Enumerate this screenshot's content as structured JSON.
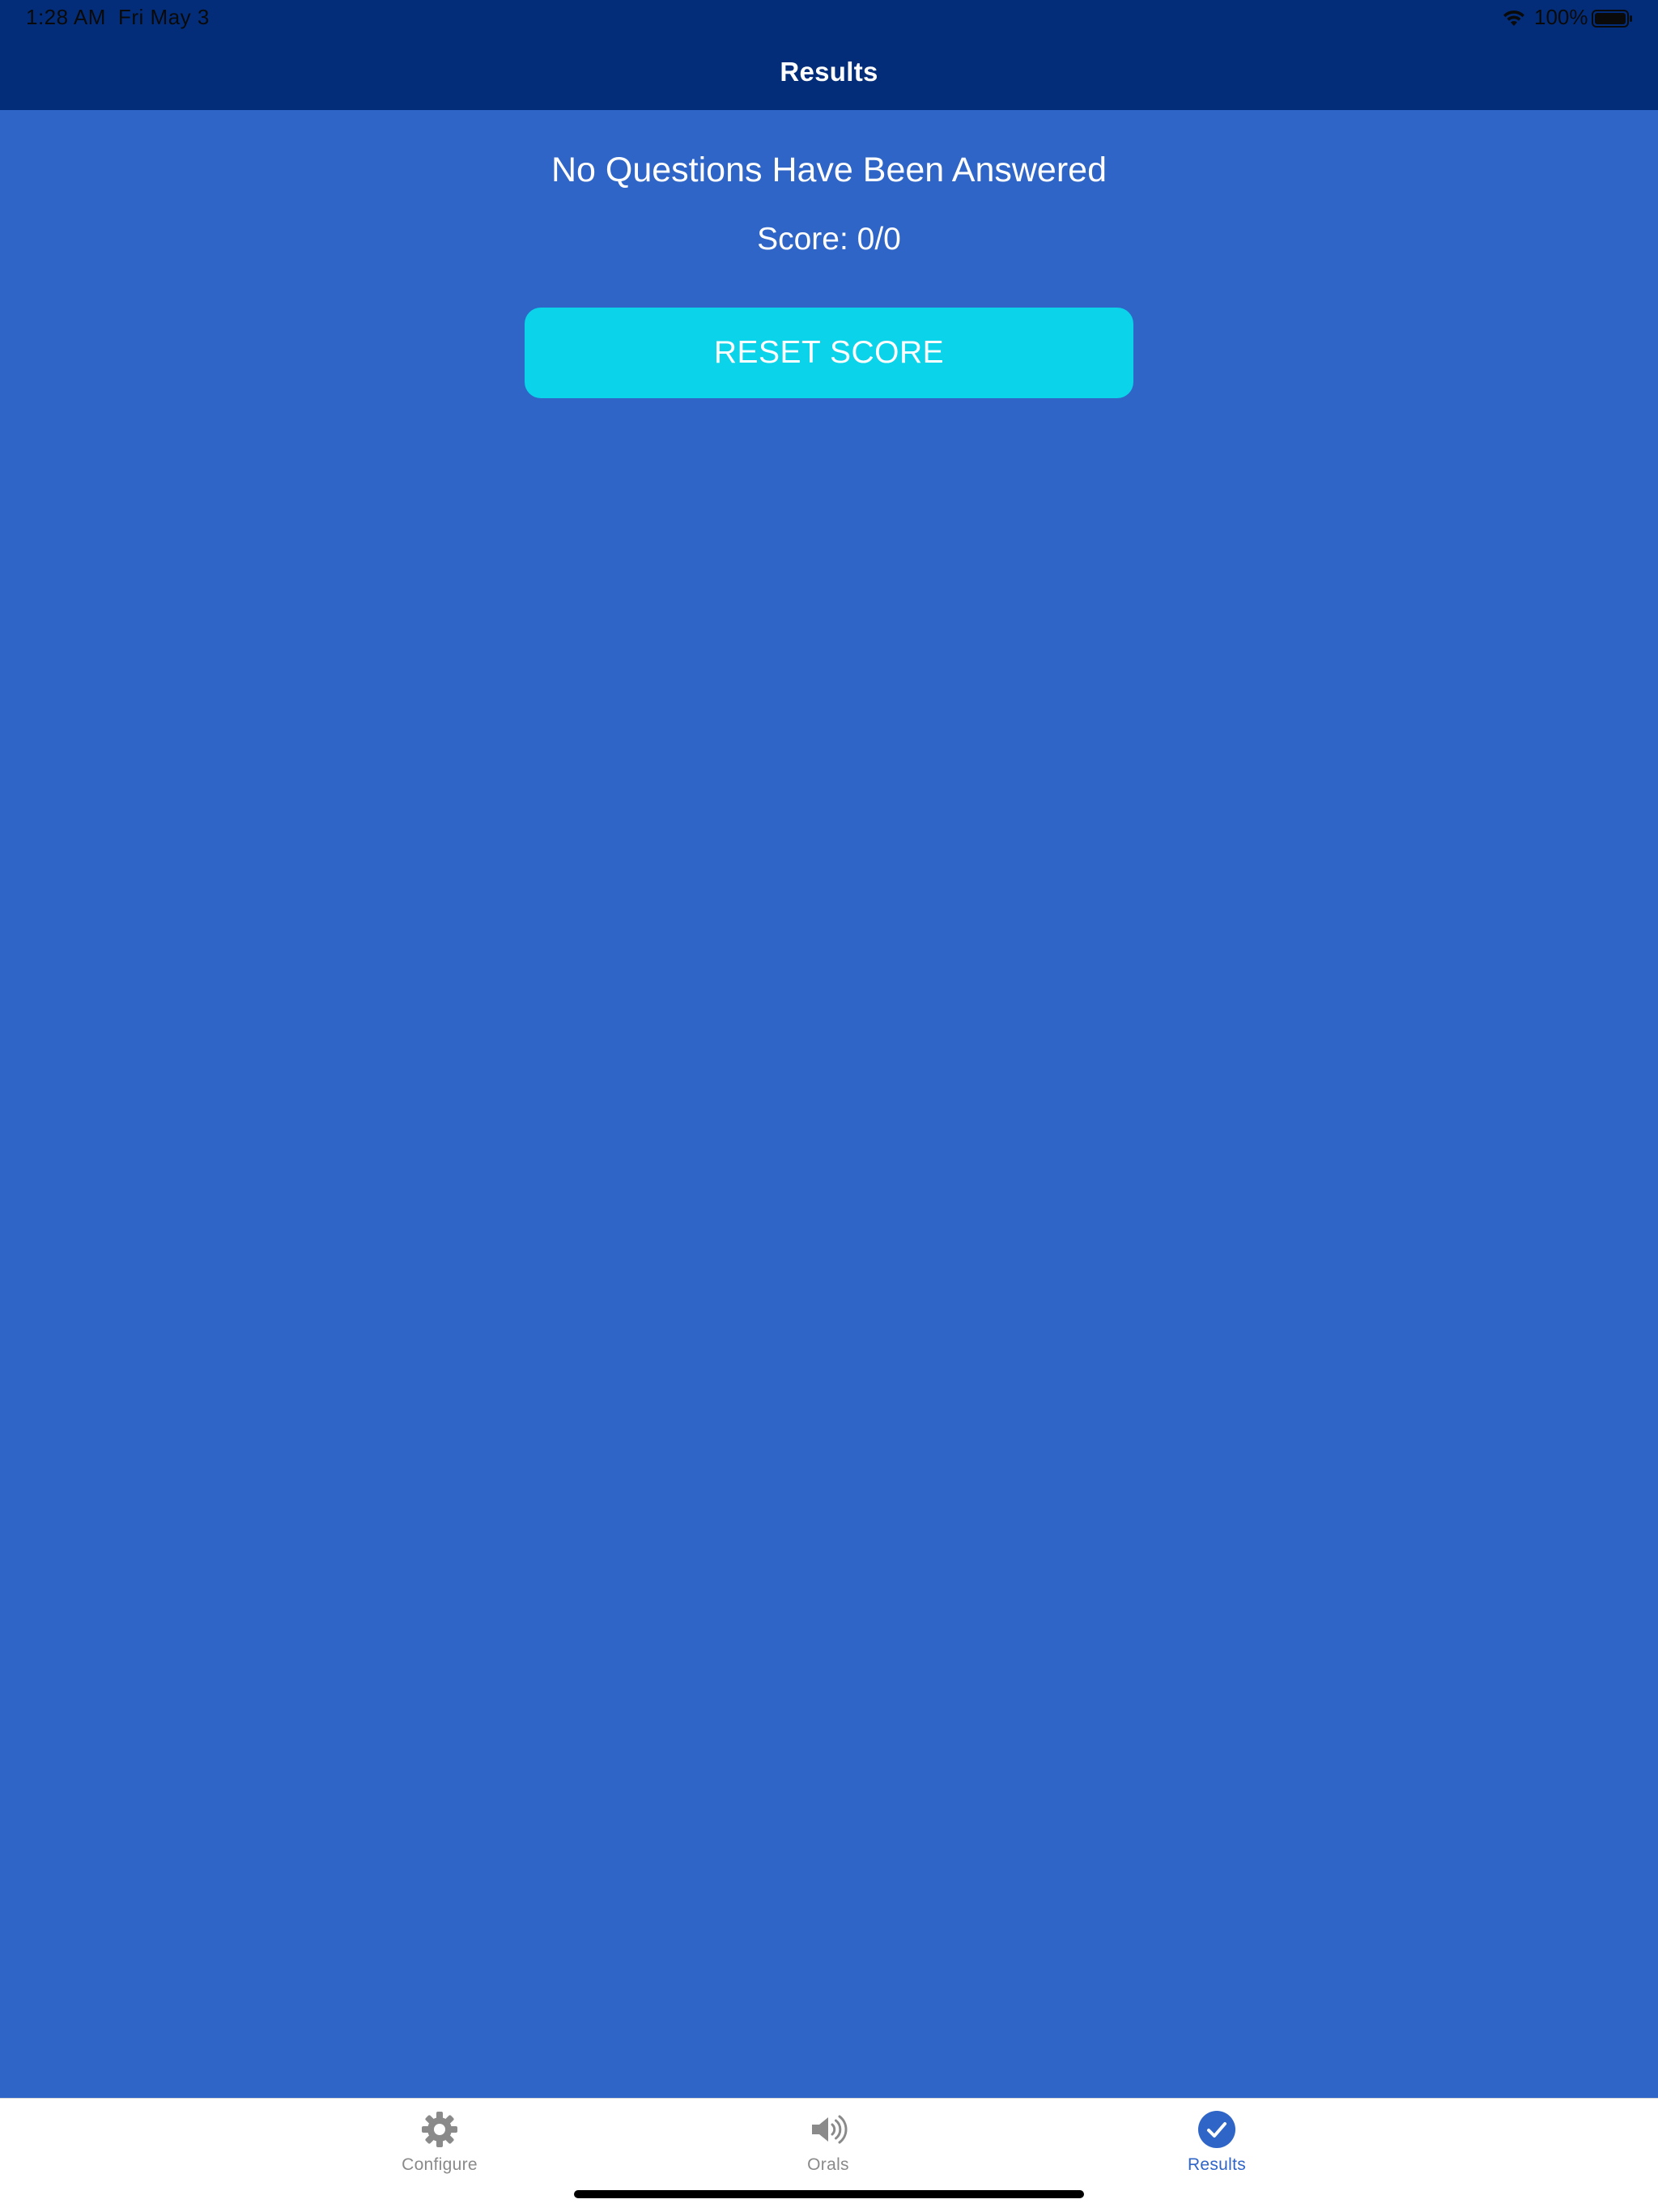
{
  "status_bar": {
    "time": "1:28 AM",
    "date": "Fri May 3",
    "battery": "100%"
  },
  "nav": {
    "title": "Results"
  },
  "main": {
    "headline": "No Questions Have Been Answered",
    "score": "Score: 0/0",
    "reset_label": "RESET SCORE"
  },
  "tabs": [
    {
      "label": "Configure",
      "icon": "gear-icon",
      "active": false
    },
    {
      "label": "Orals",
      "icon": "speaker-icon",
      "active": false
    },
    {
      "label": "Results",
      "icon": "checkmark-circle-icon",
      "active": true
    }
  ],
  "colors": {
    "header": "#042d79",
    "background": "#2f65c7",
    "button": "#0bd3ea",
    "tab_active": "#2f65c7",
    "tab_inactive": "#8a8a8a"
  }
}
